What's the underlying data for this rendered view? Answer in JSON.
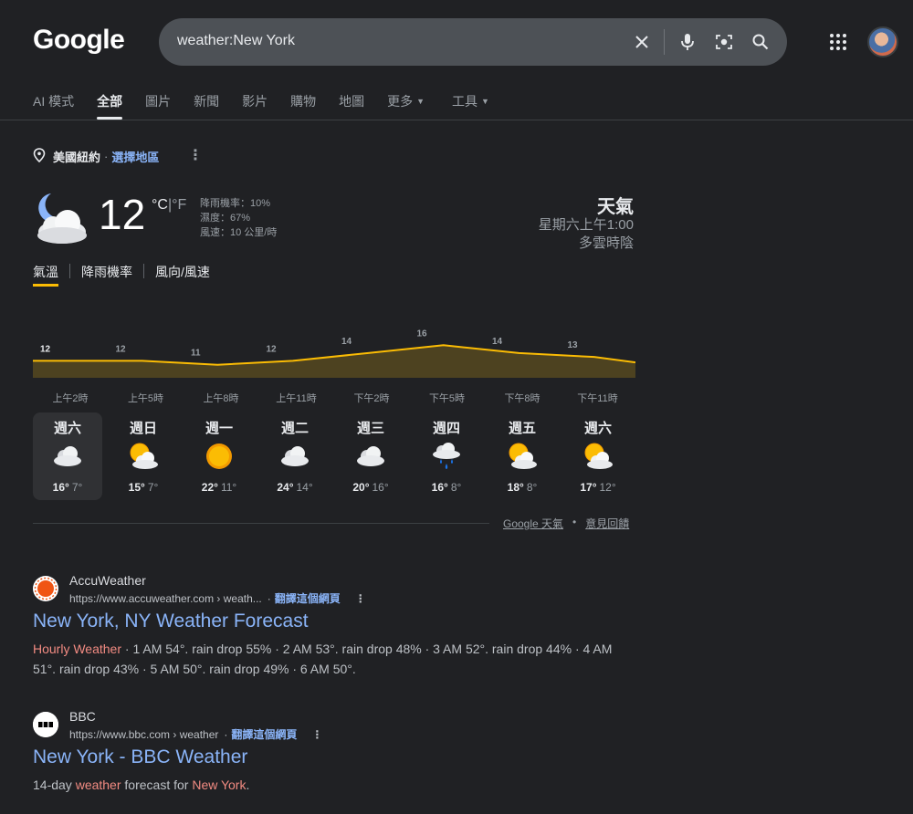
{
  "header": {
    "logo": "Google",
    "search_value": "weather:New York"
  },
  "tabs": [
    {
      "label": "AI 模式"
    },
    {
      "label": "全部",
      "active": true
    },
    {
      "label": "圖片"
    },
    {
      "label": "新聞"
    },
    {
      "label": "影片"
    },
    {
      "label": "購物"
    },
    {
      "label": "地圖"
    },
    {
      "label": "更多",
      "dropdown": true
    },
    {
      "label": "工具",
      "dropdown": true
    }
  ],
  "location": {
    "name": "美國紐約",
    "separator": "·",
    "change_link": "選擇地區"
  },
  "current": {
    "temp": "12",
    "unit_c": "°C",
    "unit_sep": "|",
    "unit_f": "°F",
    "precip": "降雨機率：10%",
    "humidity": "濕度：67%",
    "wind": "風速：10 公里/時",
    "title": "天氣",
    "time": "星期六上午1:00",
    "condition": "多雲時陰",
    "icon": "night-cloudy-icon"
  },
  "subtabs": [
    {
      "label": "氣溫",
      "active": true
    },
    {
      "label": "降雨機率"
    },
    {
      "label": "風向/風速"
    }
  ],
  "chart_data": {
    "type": "area",
    "x": [
      "上午2時",
      "上午5時",
      "上午8時",
      "上午11時",
      "下午2時",
      "下午5時",
      "下午8時",
      "下午11時"
    ],
    "values": [
      12,
      12,
      11,
      12,
      14,
      16,
      14,
      13
    ],
    "point_labels": [
      "12",
      "12",
      "11",
      "12",
      "14",
      "16",
      "14",
      "13"
    ],
    "series": [
      {
        "color": "#fbbc04"
      }
    ]
  },
  "days": [
    {
      "name": "週六",
      "hi": "16°",
      "lo": "7°",
      "icon": "cloudy-icon",
      "selected": true
    },
    {
      "name": "週日",
      "hi": "15°",
      "lo": "7°",
      "icon": "partly-sunny-icon"
    },
    {
      "name": "週一",
      "hi": "22°",
      "lo": "11°",
      "icon": "sunny-icon"
    },
    {
      "name": "週二",
      "hi": "24°",
      "lo": "14°",
      "icon": "cloudy-icon"
    },
    {
      "name": "週三",
      "hi": "20°",
      "lo": "16°",
      "icon": "cloudy-icon"
    },
    {
      "name": "週四",
      "hi": "16°",
      "lo": "8°",
      "icon": "rain-icon"
    },
    {
      "name": "週五",
      "hi": "18°",
      "lo": "8°",
      "icon": "partly-sunny-icon"
    },
    {
      "name": "週六",
      "hi": "17°",
      "lo": "12°",
      "icon": "partly-sunny-icon"
    }
  ],
  "weather_footer": {
    "source": "Google 天氣",
    "dot": "•",
    "feedback": "意見回饋"
  },
  "results": [
    {
      "site": "AccuWeather",
      "url": "https://www.accuweather.com › weath...",
      "url_sep": "·",
      "translate": "翻譯這個網頁",
      "title": "New York, NY Weather Forecast",
      "snippet_hl": "Hourly Weather",
      "snippet_rest": " · 1 AM 54°. rain drop 55% · 2 AM 53°. rain drop 48% · 3 AM 52°. rain drop 44% · 4 AM 51°. rain drop 43% · 5 AM 50°. rain drop 49% · 6 AM 50°."
    },
    {
      "site": "BBC",
      "url": "https://www.bbc.com › weather",
      "url_sep": "·",
      "translate": "翻譯這個網頁",
      "title": "New York - BBC Weather",
      "snippet_a": "14-day ",
      "snippet_hl1": "weather",
      "snippet_b": " forecast for ",
      "snippet_hl2": "New York",
      "snippet_c": "."
    }
  ],
  "colors": {
    "background": "#202124",
    "link": "#8ab4f8",
    "accent_temp": "#fbbc04",
    "highlight": "#f28b82"
  }
}
